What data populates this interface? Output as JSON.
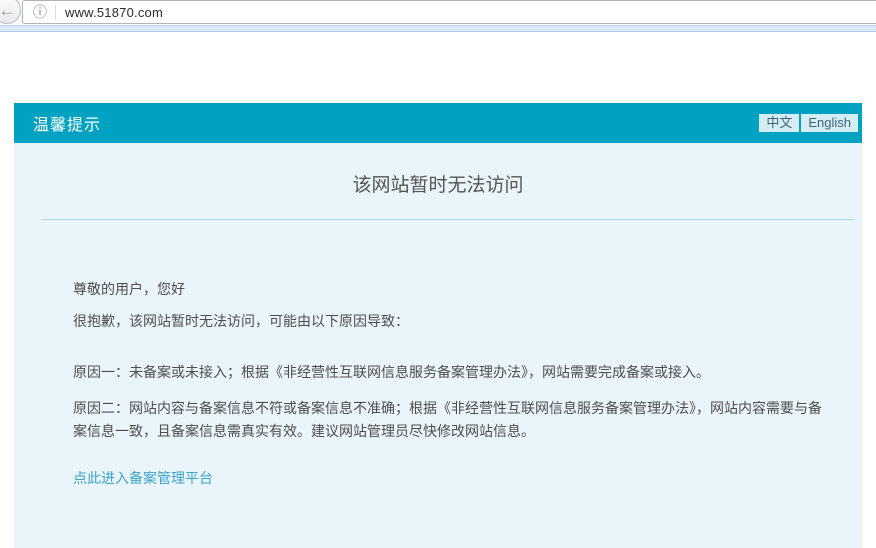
{
  "browser": {
    "back_icon": "←",
    "info_icon": "ⓘ",
    "url": "www.51870.com"
  },
  "header": {
    "title": "温馨提示",
    "lang_zh": "中文",
    "lang_en": "English"
  },
  "main": {
    "title": "该网站暂时无法访问",
    "greeting": "尊敬的用户，您好",
    "intro": "很抱歉，该网站暂时无法访问，可能由以下原因导致：",
    "reason1": "原因一：未备案或未接入；根据《非经营性互联网信息服务备案管理办法》，网站需要完成备案或接入。",
    "reason2": "原因二：网站内容与备案信息不符或备案信息不准确；根据《非经营性互联网信息服务备案管理办法》，网站内容需要与备案信息一致，且备案信息需真实有效。建议网站管理员尽快修改网站信息。",
    "portal_link": "点此进入备案管理平台"
  },
  "colors": {
    "banner_teal": "#00A1C1",
    "content_bg": "#EAF5FB",
    "divider": "#A7DBE4",
    "link_blue": "#3AA3CA",
    "body_text": "#4D4D4D",
    "lang_button_bg": "#D5EDF4"
  }
}
